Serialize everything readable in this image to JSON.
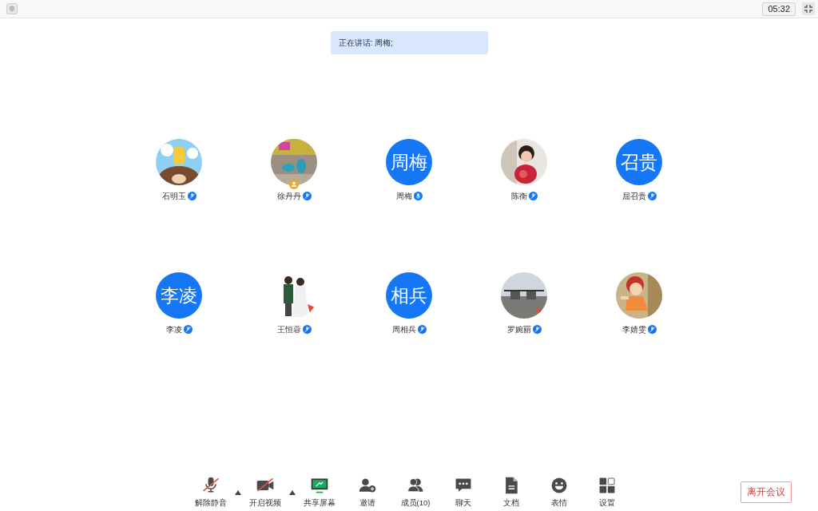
{
  "top_bar": {
    "timer": "05:32"
  },
  "speaker_banner": "正在讲话: 周梅;",
  "participants": [
    {
      "name": "石明玉",
      "kind": "picture",
      "muted": true,
      "host": false
    },
    {
      "name": "徐丹丹",
      "kind": "picture",
      "muted": true,
      "host": true
    },
    {
      "name": "周梅",
      "kind": "initials",
      "initials": "周梅",
      "muted": false,
      "host": false
    },
    {
      "name": "陈衡",
      "kind": "picture",
      "muted": true,
      "host": false
    },
    {
      "name": "屈召贵",
      "kind": "initials",
      "initials": "召贵",
      "muted": true,
      "host": false
    },
    {
      "name": "李凌",
      "kind": "initials",
      "initials": "李凌",
      "muted": true,
      "host": false
    },
    {
      "name": "王恒蓉",
      "kind": "picture",
      "muted": true,
      "host": false
    },
    {
      "name": "周相兵",
      "kind": "initials",
      "initials": "相兵",
      "muted": true,
      "host": false
    },
    {
      "name": "罗婉丽",
      "kind": "picture",
      "muted": true,
      "host": false
    },
    {
      "name": "李婧雯",
      "kind": "picture",
      "muted": true,
      "host": false
    }
  ],
  "toolbar": [
    {
      "kind": "mic",
      "label": "解除静音",
      "off": true,
      "menu": true
    },
    {
      "kind": "video",
      "label": "开启视频",
      "off": true,
      "menu": true
    },
    {
      "kind": "share",
      "label": "共享屏幕"
    },
    {
      "kind": "invite",
      "label": "邀请"
    },
    {
      "kind": "members",
      "label": "成员(10)"
    },
    {
      "kind": "chat",
      "label": "聊天"
    },
    {
      "kind": "docs",
      "label": "文档"
    },
    {
      "kind": "emoji",
      "label": "表情"
    },
    {
      "kind": "settings",
      "label": "设置"
    }
  ],
  "leave_button": "离开会议"
}
